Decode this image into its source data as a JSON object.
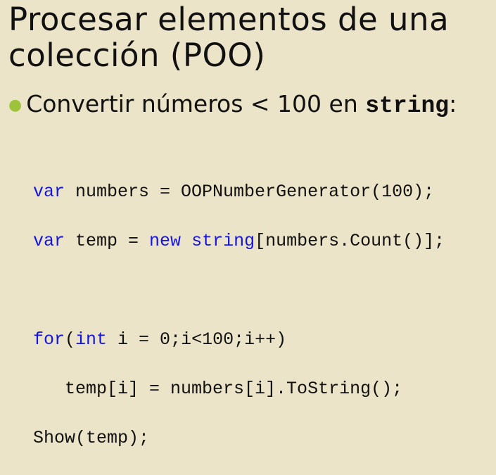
{
  "title": {
    "line1": "Procesar elementos de una",
    "line2": "colección (POO)"
  },
  "bullet": {
    "text": "Convertir números < 100 en ",
    "code": "string",
    "suffix": ":"
  },
  "code": {
    "l1": {
      "kw1": "var",
      "t1": " numbers = OOPNumberGenerator(100);"
    },
    "l2": {
      "kw1": "var",
      "t1": " temp = ",
      "kw2": "new",
      "t2": " ",
      "kw3": "string",
      "t3": "[numbers.Count()];"
    },
    "l4": {
      "kw1": "for",
      "t1": "(",
      "kw2": "int",
      "t2": " i = 0;i<100;i++)"
    },
    "l5": {
      "t1": "   temp[i] = numbers[i].ToString();"
    },
    "l6": {
      "t1": "Show(temp);"
    }
  },
  "colors": {
    "background": "#ebe4c8",
    "keyword": "#1515e0",
    "bullet": "#9dc33b"
  }
}
